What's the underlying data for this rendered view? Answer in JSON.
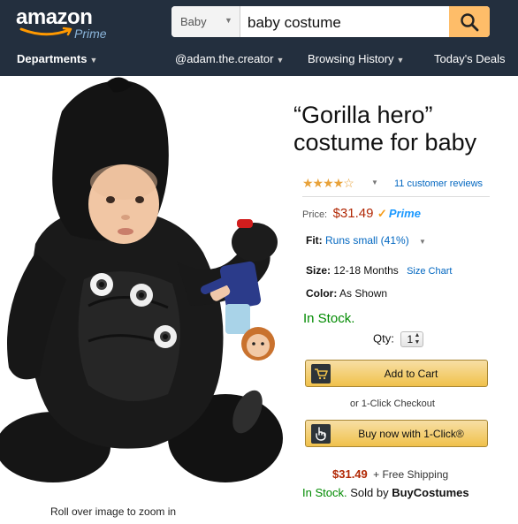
{
  "header": {
    "logo_text": "amazon",
    "logo_sub": "Prime",
    "search_category": "Baby",
    "search_value": "baby costume",
    "nav": {
      "departments": "Departments",
      "user": "@adam.the.creator",
      "history": "Browsing History",
      "deals": "Today's Deals"
    }
  },
  "product": {
    "title": "“Gorilla hero” costume for baby",
    "rating_stars": "★★★★☆",
    "reviews": "11 customer reviews",
    "price_label": "Price:",
    "price": "$31.49",
    "prime": "Prime",
    "fit_label": "Fit:",
    "fit_value": "Runs small (41%)",
    "size_label": "Size:",
    "size_value": "12-18 Months",
    "size_chart": "Size Chart",
    "color_label": "Color:",
    "color_value": "As Shown",
    "stock": "In Stock.",
    "qty_label": "Qty:",
    "qty_value": "1",
    "add_to_cart": "Add to Cart",
    "one_click_checkout": "or 1-Click Checkout",
    "buy_now": "Buy now with 1-Click®",
    "ship_price": "$31.49",
    "ship_text": "+ Free Shipping",
    "seller_stock": "In Stock.",
    "seller_by": "Sold by",
    "seller_name": "BuyCostumes",
    "zoom_hint": "Roll over image to zoom in"
  },
  "colors": {
    "header_bg": "#232f3e",
    "search_button": "#febd69",
    "price": "#b12704",
    "in_stock": "#008a00",
    "link": "#0066c0",
    "button": "#f0c14b"
  }
}
